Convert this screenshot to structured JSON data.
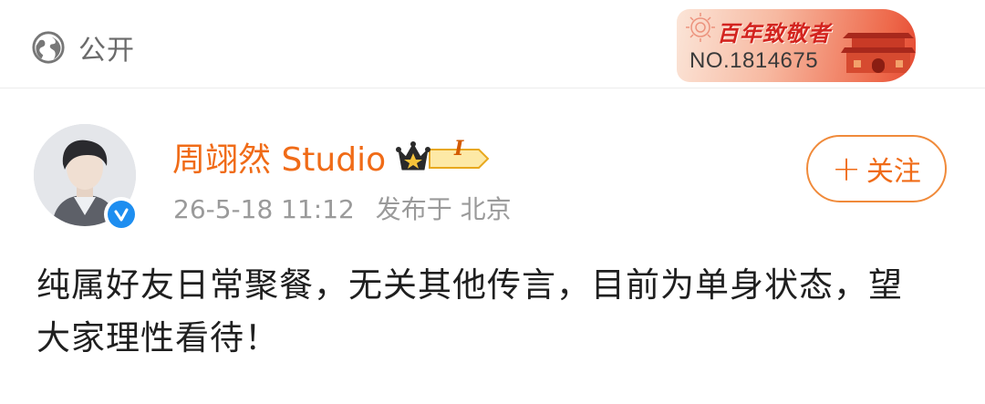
{
  "header": {
    "visibility_icon": "globe-icon",
    "visibility_label": "公开",
    "badge": {
      "title": "百年致敬者",
      "number": "NO.1814675"
    }
  },
  "author": {
    "name": "周翊然 Studio",
    "verified_icon": "verified-icon",
    "member_badge_icon": "crown-level-icon",
    "member_level": "I"
  },
  "meta": {
    "time": "26-5-18 11:12",
    "source": "发布于 北京"
  },
  "follow_button": {
    "plus": "+",
    "label": "关注"
  },
  "post": {
    "text": "纯属好友日常聚餐，无关其他传言，目前为单身状态，望大家理性看待！"
  },
  "colors": {
    "accent": "#f06b17",
    "verified": "#1e8ef0",
    "meta": "#9a9a9a"
  }
}
